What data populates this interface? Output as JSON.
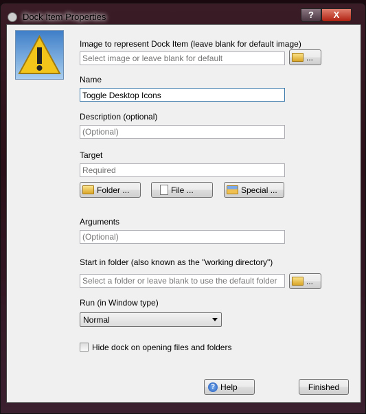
{
  "window": {
    "title": "Dock Item Properties",
    "help_label": "?",
    "close_label": "X"
  },
  "image": {
    "label": "Image to represent Dock Item (leave blank for default image)",
    "placeholder": "Select image or leave blank for default",
    "browse_label": "..."
  },
  "name": {
    "label": "Name",
    "value": "Toggle Desktop Icons"
  },
  "description": {
    "label": "Description (optional)",
    "placeholder": "(Optional)"
  },
  "target": {
    "label": "Target",
    "placeholder": "Required",
    "folder_label": "Folder ...",
    "file_label": "File ...",
    "special_label": "Special ..."
  },
  "arguments": {
    "label": "Arguments",
    "placeholder": "(Optional)"
  },
  "start_in": {
    "label": "Start in folder (also known as the \"working directory\")",
    "placeholder": "Select a folder or leave blank to use the default folder",
    "browse_label": "..."
  },
  "run": {
    "label": "Run (in  Window type)",
    "selected": "Normal"
  },
  "hide_dock": {
    "label": "Hide dock on opening files and folders",
    "checked": false
  },
  "footer": {
    "help_label": "Help",
    "finished_label": "Finished"
  },
  "icon": "warning-icon"
}
